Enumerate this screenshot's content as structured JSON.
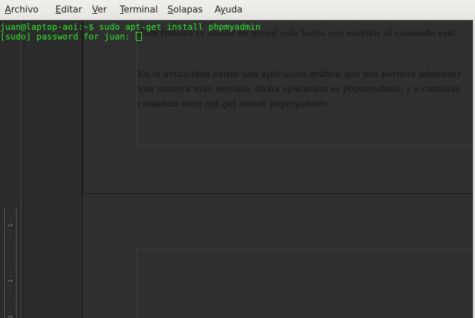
{
  "menubar": {
    "items": [
      {
        "label": "Archivo",
        "mnemonic": "A",
        "rest": "rchivo"
      },
      {
        "label": "Editar",
        "mnemonic": "E",
        "rest": "ditar"
      },
      {
        "label": "Ver",
        "mnemonic": "V",
        "rest": "er"
      },
      {
        "label": "Terminal",
        "mnemonic": "T",
        "rest": "erminal"
      },
      {
        "label": "Solapas",
        "mnemonic": "S",
        "rest": "olapas"
      },
      {
        "label": "Ayuda",
        "mnemonic": "y",
        "prefix": "A",
        "rest": "uda"
      }
    ]
  },
  "terminal": {
    "prompt": "juan@laptop-aoi:~$ ",
    "command": "sudo apt-get install phpmyadmin",
    "password_prompt": "[sudo] password for juan: "
  },
  "background_document": {
    "line1": "Para finaliza la sesión en mysql solo basta con escribir el comando ",
    "line1_em": "exit.",
    "line2": "En la actualidad existe una aplicacion gráfica que nos permite administr",
    "line3": "una manera muy sencilla, dicha aplicación es phpmyadmin, y a continua",
    "line4_pre": "comando ",
    "line4_em": "sudo apt-get install phpmyadmin",
    "line4_post": ".",
    "ruler_marks": [
      "· · 1 · ·",
      "· · 1 · ·",
      "2 ·"
    ]
  },
  "colors": {
    "terminal_bg": "#2b2b2b",
    "terminal_fg": "#2ee82e",
    "menubar_bg": "#ecebe8"
  }
}
